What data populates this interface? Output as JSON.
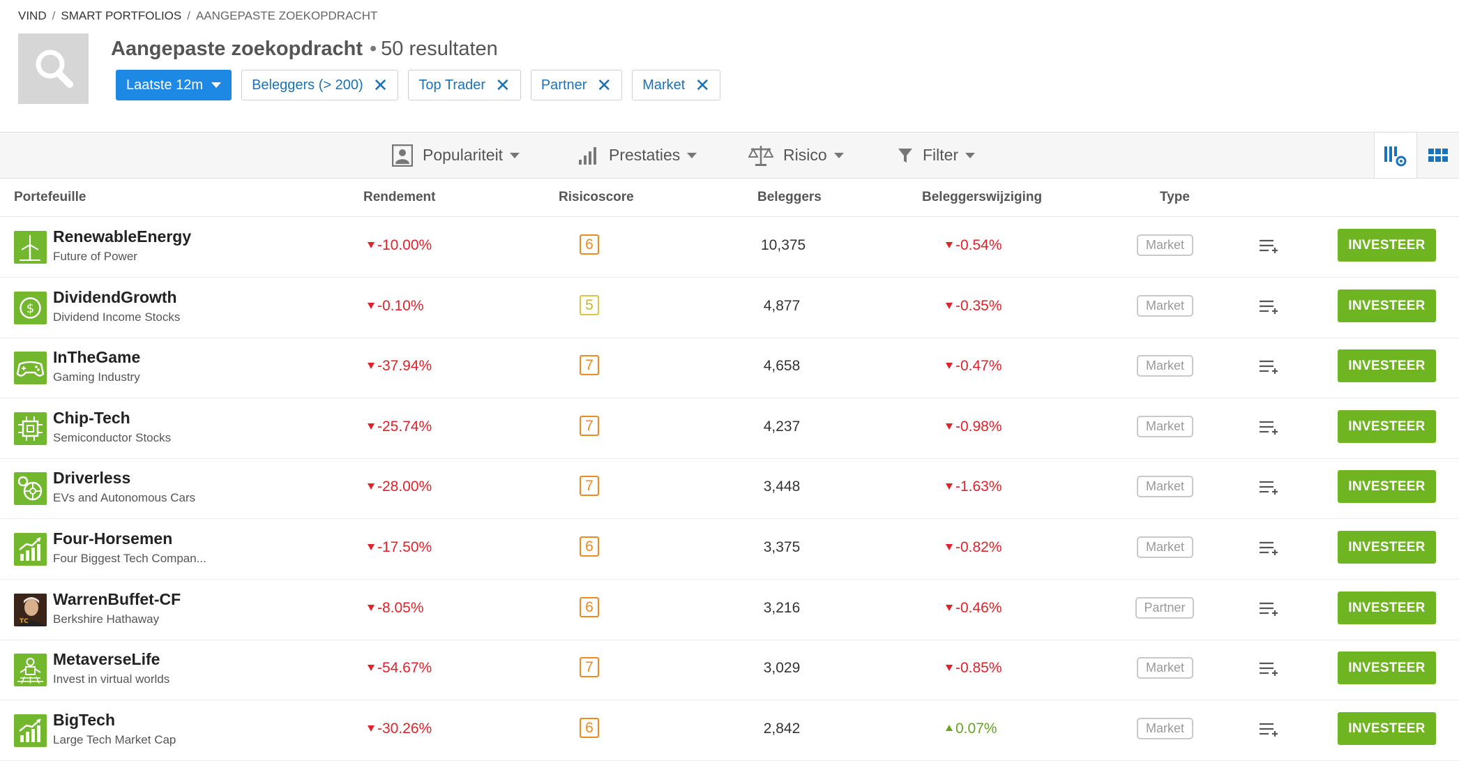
{
  "breadcrumb": {
    "items": [
      "VIND",
      "SMART PORTFOLIOS"
    ],
    "current": "AANGEPASTE ZOEKOPDRACHT"
  },
  "header": {
    "title": "Aangepaste zoekopdracht",
    "results": "50 resultaten"
  },
  "filters": {
    "period": "Laatste 12m",
    "chips": [
      "Beleggers (> 200)",
      "Top Trader",
      "Partner",
      "Market"
    ]
  },
  "toolbar": {
    "popularity": "Populariteit",
    "performance": "Prestaties",
    "risk": "Risico",
    "filter": "Filter"
  },
  "columns": {
    "portfolio": "Portefeuille",
    "return": "Rendement",
    "risk": "Risicoscore",
    "investors": "Beleggers",
    "change": "Beleggerswijziging",
    "type": "Type"
  },
  "invest_label": "INVESTEER",
  "rows": [
    {
      "name": "RenewableEnergy",
      "sub": "Future of Power",
      "return": "-10.00%",
      "risk": "6",
      "investors": "10,375",
      "change": "-0.54%",
      "type": "Market",
      "icon": "wind-turbine-icon"
    },
    {
      "name": "DividendGrowth",
      "sub": "Dividend Income Stocks",
      "return": "-0.10%",
      "risk": "5",
      "investors": "4,877",
      "change": "-0.35%",
      "type": "Market",
      "icon": "dollar-coin-icon"
    },
    {
      "name": "InTheGame",
      "sub": "Gaming Industry",
      "return": "-37.94%",
      "risk": "7",
      "investors": "4,658",
      "change": "-0.47%",
      "type": "Market",
      "icon": "gamepad-icon"
    },
    {
      "name": "Chip-Tech",
      "sub": "Semiconductor Stocks",
      "return": "-25.74%",
      "risk": "7",
      "investors": "4,237",
      "change": "-0.98%",
      "type": "Market",
      "icon": "chip-icon"
    },
    {
      "name": "Driverless",
      "sub": "EVs and Autonomous Cars",
      "return": "-28.00%",
      "risk": "7",
      "investors": "3,448",
      "change": "-1.63%",
      "type": "Market",
      "icon": "car-wheel-icon"
    },
    {
      "name": "Four-Horsemen",
      "sub": "Four Biggest Tech Compan...",
      "return": "-17.50%",
      "risk": "6",
      "investors": "3,375",
      "change": "-0.82%",
      "type": "Market",
      "icon": "growth-chart-icon"
    },
    {
      "name": "WarrenBuffet-CF",
      "sub": "Berkshire Hathaway",
      "return": "-8.05%",
      "risk": "6",
      "investors": "3,216",
      "change": "-0.46%",
      "type": "Partner",
      "icon": "portrait-photo"
    },
    {
      "name": "MetaverseLife",
      "sub": "Invest in virtual worlds",
      "return": "-54.67%",
      "risk": "7",
      "investors": "3,029",
      "change": "-0.85%",
      "type": "Market",
      "icon": "vr-person-icon"
    },
    {
      "name": "BigTech",
      "sub": "Large Tech Market Cap",
      "return": "-30.26%",
      "risk": "6",
      "investors": "2,842",
      "change": "0.07%",
      "type": "Market",
      "icon": "growth-chart-icon"
    }
  ]
}
